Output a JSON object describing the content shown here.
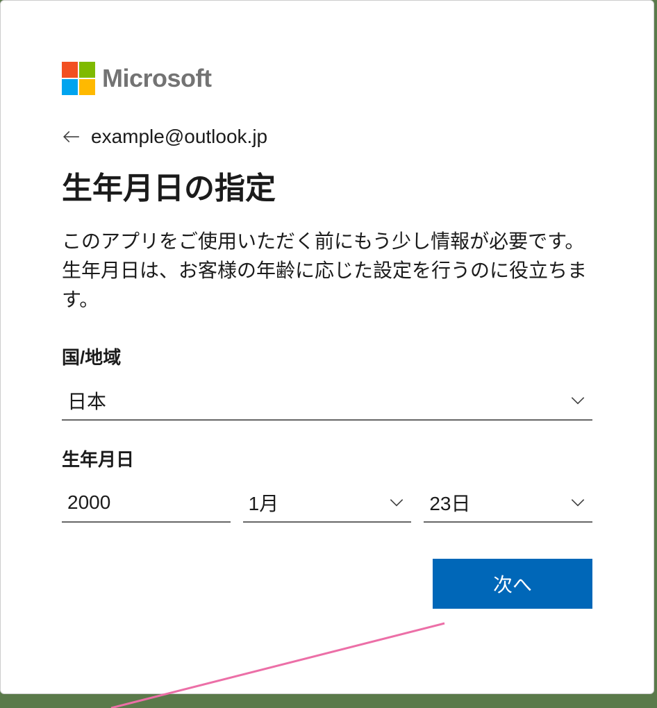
{
  "brand": {
    "name": "Microsoft"
  },
  "identity": {
    "email": "example@outlook.jp"
  },
  "page": {
    "title": "生年月日の指定",
    "description": "このアプリをご使用いただく前にもう少し情報が必要です。生年月日は、お客様の年齢に応じた設定を行うのに役立ちます。"
  },
  "fields": {
    "country": {
      "label": "国/地域",
      "value": "日本"
    },
    "dob": {
      "label": "生年月日",
      "year": "2000",
      "month": "1月",
      "day": "23日"
    }
  },
  "buttons": {
    "next": "次へ"
  }
}
